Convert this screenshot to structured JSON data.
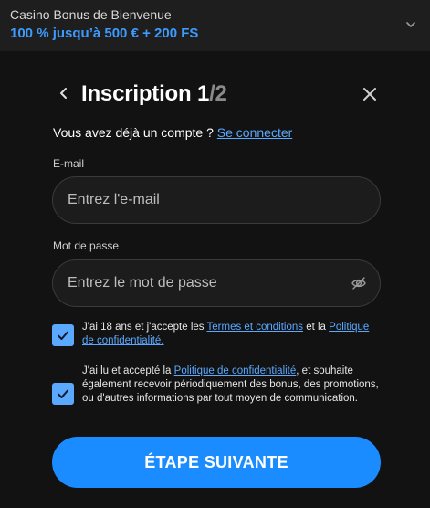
{
  "banner": {
    "title": "Casino Bonus de Bienvenue",
    "offer": "100 % jusqu’à 500 € + 200 FS"
  },
  "header": {
    "title_main": "Inscription 1",
    "title_sep": "/2"
  },
  "account": {
    "prompt": "Vous avez déjà un compte ?",
    "login_link": "Se connecter"
  },
  "email": {
    "label": "E-mail",
    "placeholder": "Entrez l'e-mail",
    "value": ""
  },
  "password": {
    "label": "Mot de passe",
    "placeholder": "Entrez le mot de passe",
    "value": ""
  },
  "consent_terms": {
    "checked": true,
    "text_1": "J'ai 18 ans et j'accepte les",
    "link_terms": "Termes et conditions",
    "text_2": "et la",
    "link_privacy": "Politique de confidentialité."
  },
  "consent_marketing": {
    "checked": true,
    "text_1": "J'ai lu et accepté la",
    "link_privacy": "Politique de confidentialité",
    "text_2": ", et souhaite également recevoir périodiquement des bonus, des promotions, ou d'autres informations par tout moyen de communication."
  },
  "actions": {
    "next_label": "ÉTAPE SUIVANTE"
  },
  "colors": {
    "accent": "#1a8cff",
    "link": "#5aa9ff",
    "offer": "#3d9bff",
    "background": "#121212"
  },
  "icons": {
    "banner_toggle": "chevron-down-icon",
    "back": "chevron-left-icon",
    "close": "close-icon",
    "password_visibility": "eye-off-icon",
    "checkbox": "checkmark-icon"
  }
}
